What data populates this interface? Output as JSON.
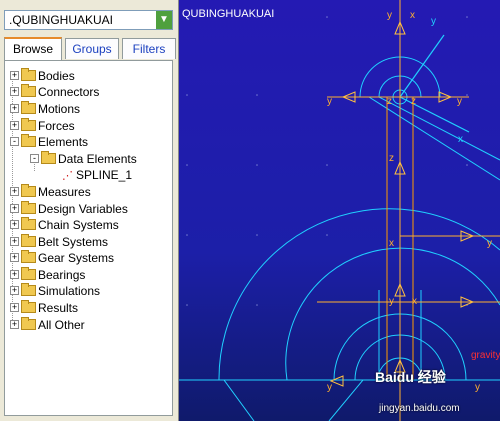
{
  "model_selector": {
    "value": ".QUBINGHUAKUAI"
  },
  "tabs": [
    {
      "label": "Browse",
      "active": true
    },
    {
      "label": "Groups",
      "active": false
    },
    {
      "label": "Filters",
      "active": false
    }
  ],
  "tree": [
    {
      "label": "Bodies",
      "expander": "+"
    },
    {
      "label": "Connectors",
      "expander": "+"
    },
    {
      "label": "Motions",
      "expander": "+"
    },
    {
      "label": "Forces",
      "expander": "+"
    },
    {
      "label": "Elements",
      "expander": "-"
    },
    {
      "label": "Data Elements",
      "expander": "-"
    },
    {
      "label": "SPLINE_1"
    },
    {
      "label": "Measures",
      "expander": "+"
    },
    {
      "label": "Design Variables",
      "expander": "+"
    },
    {
      "label": "Chain Systems",
      "expander": "+"
    },
    {
      "label": "Belt Systems",
      "expander": "+"
    },
    {
      "label": "Gear Systems",
      "expander": "+"
    },
    {
      "label": "Bearings",
      "expander": "+"
    },
    {
      "label": "Simulations",
      "expander": "+"
    },
    {
      "label": "Results",
      "expander": "+"
    },
    {
      "label": "All Other",
      "expander": "+"
    }
  ],
  "viewport": {
    "model_name": "QUBINGHUAKUAI",
    "axis_x": "x",
    "axis_y": "y",
    "axis_z": "z",
    "gravity_label": "gravity"
  },
  "watermark": {
    "logo": "Baidu 经验",
    "url": "jingyan.baidu.com"
  }
}
